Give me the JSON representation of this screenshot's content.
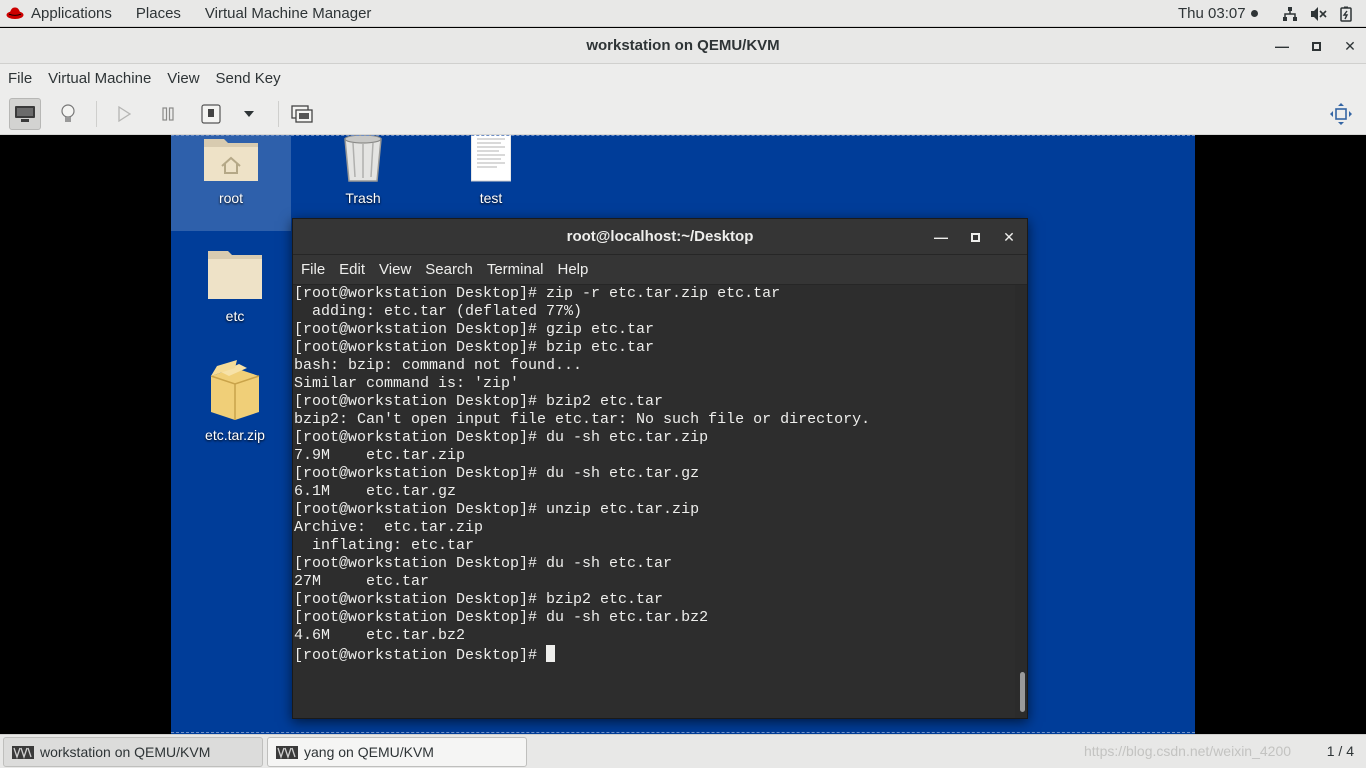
{
  "topbar": {
    "applications": "Applications",
    "places": "Places",
    "app_menu": "Virtual Machine Manager",
    "clock": "Thu 03:07",
    "icons": [
      "network-icon",
      "volume-icon",
      "power-icon"
    ]
  },
  "vm_window": {
    "title": "workstation on QEMU/KVM",
    "menu": [
      "File",
      "Virtual Machine",
      "View",
      "Send Key"
    ]
  },
  "guest_desktop": {
    "icons": [
      {
        "label": "root",
        "type": "home-folder-icon"
      },
      {
        "label": "Trash",
        "type": "trash-icon"
      },
      {
        "label": "test",
        "type": "document-icon"
      },
      {
        "label": "etc",
        "type": "folder-icon"
      },
      {
        "label": "etc.tar.zip",
        "type": "archive-icon"
      }
    ]
  },
  "terminal": {
    "title": "root@localhost:~/Desktop",
    "menu": [
      "File",
      "Edit",
      "View",
      "Search",
      "Terminal",
      "Help"
    ],
    "lines": [
      "[root@workstation Desktop]# zip -r etc.tar.zip etc.tar",
      "  adding: etc.tar (deflated 77%)",
      "[root@workstation Desktop]# gzip etc.tar",
      "[root@workstation Desktop]# bzip etc.tar",
      "bash: bzip: command not found...",
      "Similar command is: 'zip'",
      "[root@workstation Desktop]# bzip2 etc.tar",
      "bzip2: Can't open input file etc.tar: No such file or directory.",
      "[root@workstation Desktop]# du -sh etc.tar.zip",
      "7.9M    etc.tar.zip",
      "[root@workstation Desktop]# du -sh etc.tar.gz",
      "6.1M    etc.tar.gz",
      "[root@workstation Desktop]# unzip etc.tar.zip",
      "Archive:  etc.tar.zip",
      "  inflating: etc.tar",
      "[root@workstation Desktop]# du -sh etc.tar",
      "27M     etc.tar",
      "[root@workstation Desktop]# bzip2 etc.tar",
      "[root@workstation Desktop]# du -sh etc.tar.bz2",
      "4.6M    etc.tar.bz2"
    ],
    "prompt": "[root@workstation Desktop]# "
  },
  "taskbar": {
    "tasks": [
      "workstation on QEMU/KVM",
      "yang on QEMU/KVM"
    ],
    "watermark": "https://blog.csdn.net/weixin_4200",
    "workspace": "1 / 4"
  }
}
